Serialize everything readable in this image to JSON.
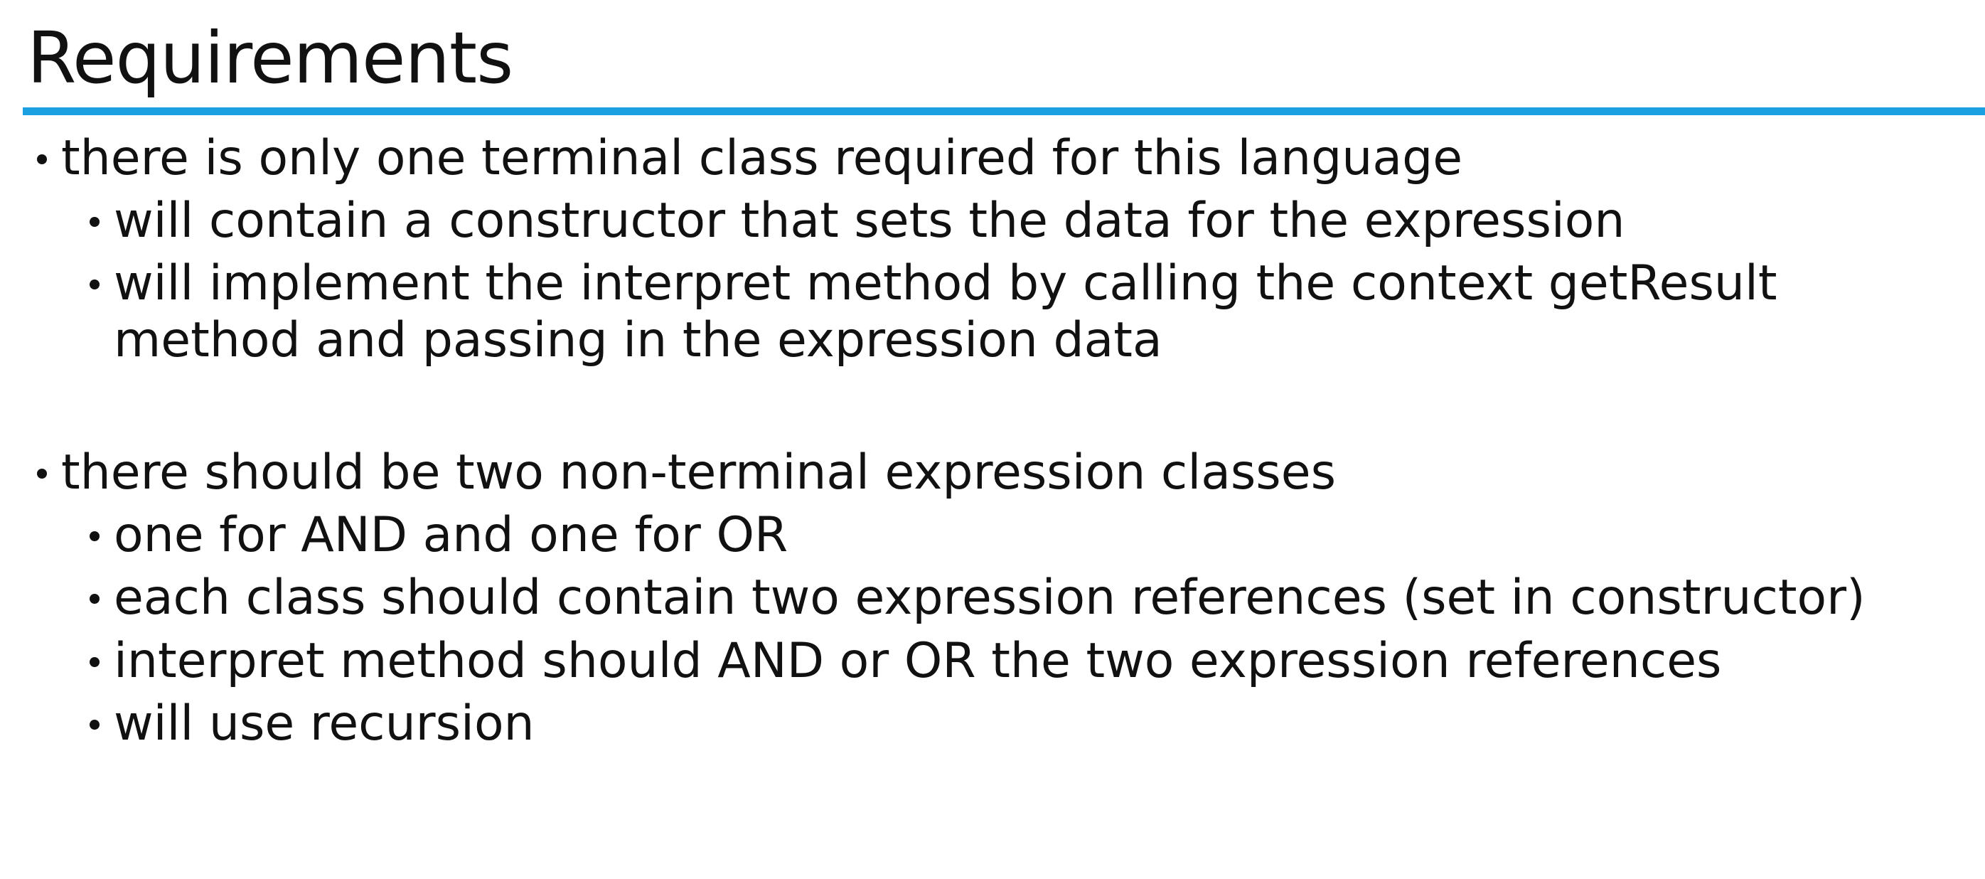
{
  "slide": {
    "title": "Requirements",
    "accent_color": "#1ba1e2",
    "bullets": [
      {
        "level": 1,
        "text": "there is only one terminal class required for this language"
      },
      {
        "level": 2,
        "text": "will contain a constructor that sets the data for the expression"
      },
      {
        "level": 2,
        "text": "will implement the interpret method by calling the context getResult method and passing in the expression data"
      },
      {
        "level": 1,
        "text": "there should be two non-terminal expression classes"
      },
      {
        "level": 2,
        "text": "one for AND and one for OR"
      },
      {
        "level": 2,
        "text": "each class should contain two expression references (set in constructor)"
      },
      {
        "level": 2,
        "text": "interpret method should AND or OR the two expression references"
      },
      {
        "level": 2,
        "text": "will use recursion"
      }
    ]
  }
}
